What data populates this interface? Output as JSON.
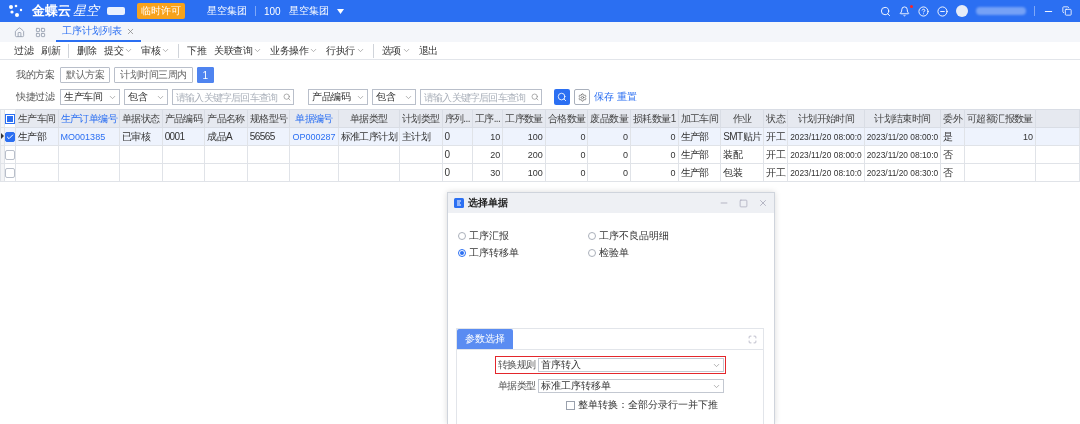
{
  "top_bar": {
    "brand": "金蝶云",
    "brand_suffix": "星空",
    "license_badge": "临时许可",
    "org": "星空集团",
    "org_code": "100",
    "org_name": "星空集团",
    "unread": true
  },
  "tabs": [
    {
      "label": "工序计划列表",
      "selected": true
    }
  ],
  "toolbar": [
    {
      "label": "过滤",
      "dropdown": false,
      "divider_after": false
    },
    {
      "label": "刷新",
      "dropdown": false,
      "divider_after": true
    },
    {
      "label": "删除",
      "dropdown": false,
      "divider_after": false
    },
    {
      "label": "提交",
      "dropdown": true,
      "divider_after": false
    },
    {
      "label": "审核",
      "dropdown": true,
      "divider_after": true
    },
    {
      "label": "下推",
      "dropdown": false,
      "divider_after": false
    },
    {
      "label": "关联查询",
      "dropdown": true,
      "divider_after": false
    },
    {
      "label": "业务操作",
      "dropdown": true,
      "divider_after": false
    },
    {
      "label": "行执行",
      "dropdown": true,
      "divider_after": true
    },
    {
      "label": "选项",
      "dropdown": true,
      "divider_after": false
    },
    {
      "label": "退出",
      "dropdown": false,
      "divider_after": false
    }
  ],
  "scheme": {
    "label": "我的方案",
    "options": [
      {
        "label": "默认方案",
        "selected": false
      },
      {
        "label": "计划时间三周内",
        "selected": false
      },
      {
        "label": "1",
        "selected": true
      }
    ]
  },
  "quick_filter": {
    "label": "快捷过滤",
    "groups": [
      {
        "field": "生产车间",
        "operator": "包含",
        "placeholder": "请输入关键字后回车查询"
      },
      {
        "field": "产品编码",
        "operator": "包含",
        "placeholder": "请输入关键字后回车查询"
      }
    ],
    "links": [
      "保存",
      "重置"
    ]
  },
  "table": {
    "header_checkbox_partial": true,
    "columns": [
      {
        "label": "生产车间",
        "kind": "text"
      },
      {
        "label": "生产订单编号",
        "kind": "link"
      },
      {
        "label": "单据状态",
        "kind": "text"
      },
      {
        "label": "产品编码",
        "kind": "text"
      },
      {
        "label": "产品名称",
        "kind": "text"
      },
      {
        "label": "规格型号",
        "kind": "text"
      },
      {
        "label": "单据编号",
        "kind": "link"
      },
      {
        "label": "单据类型",
        "kind": "text"
      },
      {
        "label": "计划类型",
        "kind": "text"
      },
      {
        "label": "序列...",
        "kind": "text"
      },
      {
        "label": "工序...",
        "kind": "number"
      },
      {
        "label": "工序数量",
        "kind": "number"
      },
      {
        "label": "合格数量",
        "kind": "number"
      },
      {
        "label": "废品数量",
        "kind": "number"
      },
      {
        "label": "损耗数量1",
        "kind": "number"
      },
      {
        "label": "加工车间",
        "kind": "text"
      },
      {
        "label": "作业",
        "kind": "text"
      },
      {
        "label": "状态",
        "kind": "text"
      },
      {
        "label": "计划开始时间",
        "kind": "time"
      },
      {
        "label": "计划结束时间",
        "kind": "time"
      },
      {
        "label": "委外",
        "kind": "text"
      },
      {
        "label": "可超额汇报数量",
        "kind": "number"
      }
    ],
    "rows": [
      {
        "selected": true,
        "checked": true,
        "cells": [
          "生产部",
          "MO001385",
          "已审核",
          "0001",
          "成品A",
          "56565",
          "OP000287",
          "标准工序计划",
          "主计划",
          "0",
          "10",
          "100",
          "0",
          "0",
          "0",
          "生产部",
          "SMT贴片",
          "开工",
          "2023/11/20 08:00:0",
          "2023/11/20 08:00:0",
          "是",
          "10"
        ]
      },
      {
        "selected": false,
        "checked": false,
        "cells": [
          null,
          null,
          null,
          null,
          null,
          null,
          null,
          null,
          null,
          "0",
          "20",
          "200",
          "0",
          "0",
          "0",
          "生产部",
          "装配",
          "开工",
          "2023/11/20 08:00:0",
          "2023/11/20 08:10:0",
          "否",
          null
        ]
      },
      {
        "selected": false,
        "checked": false,
        "cells": [
          null,
          null,
          null,
          null,
          null,
          null,
          null,
          null,
          null,
          "0",
          "30",
          "100",
          "0",
          "0",
          "0",
          "生产部",
          "包装",
          "开工",
          "2023/11/20 08:10:0",
          "2023/11/20 08:30:0",
          "否",
          null
        ]
      }
    ]
  },
  "dialog": {
    "title": "选择单据",
    "options": [
      {
        "label": "工序汇报",
        "selected": false
      },
      {
        "label": "工序不良品明细",
        "selected": false
      },
      {
        "label": "工序转移单",
        "selected": true
      },
      {
        "label": "检验单",
        "selected": false
      }
    ],
    "panel_tab": "参数选择",
    "fields": [
      {
        "label": "转换规则",
        "value": "首序转入",
        "highlighted": true
      },
      {
        "label": "单据类型",
        "value": "标准工序转移单",
        "highlighted": false
      }
    ],
    "whole_order": {
      "label": "整单转换：全部分录行一并下推",
      "checked": false
    }
  }
}
